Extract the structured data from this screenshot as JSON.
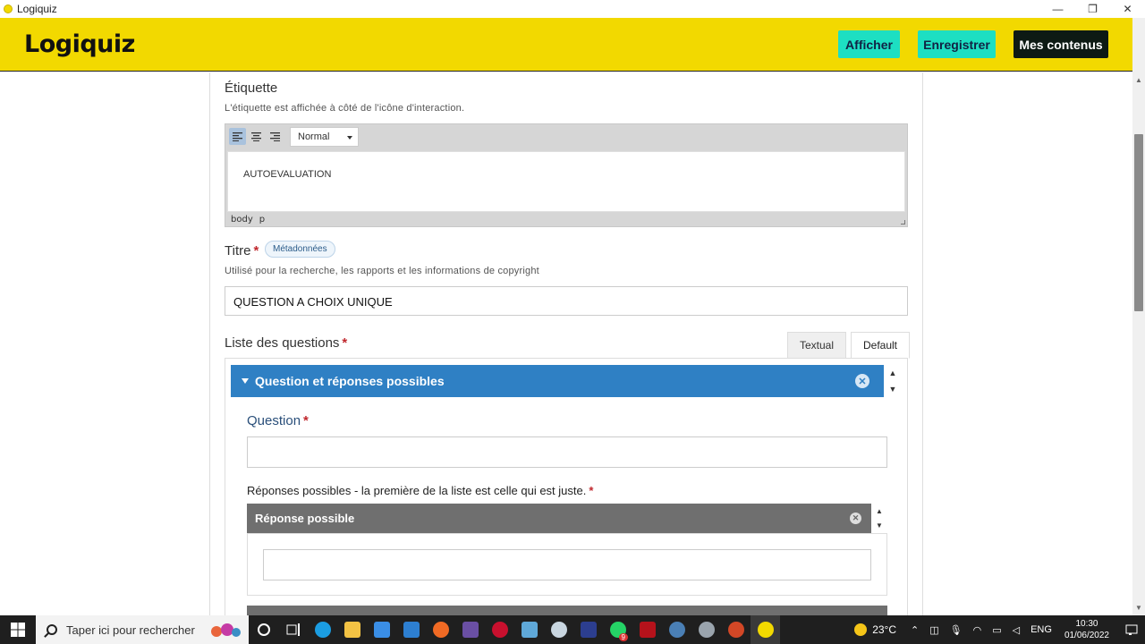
{
  "window": {
    "title": "Logiquiz",
    "minimize": "—",
    "restore": "❐",
    "close": "✕"
  },
  "header": {
    "logo": "Logiquiz",
    "btn_afficher": "Afficher",
    "btn_enregistrer": "Enregistrer",
    "btn_mes_contenus": "Mes contenus",
    "accent_color": "#f2d900",
    "button_color": "#1ddfc2"
  },
  "etiquette": {
    "label": "Étiquette",
    "description": "L'étiquette est affichée à côté de l'icône d'interaction.",
    "format_select": "Normal",
    "content": "AUTOEVALUATION",
    "path": [
      "body",
      "p"
    ]
  },
  "titre": {
    "label": "Titre",
    "required": "*",
    "badge": "Métadonnées",
    "description": "Utilisé pour la recherche, les rapports et les informations de copyright",
    "value": "QUESTION A CHOIX UNIQUE"
  },
  "questions": {
    "label": "Liste des questions",
    "required": "*",
    "tabs": [
      {
        "label": "Textual"
      },
      {
        "label": "Default"
      }
    ],
    "item_title": "Question et réponses possibles",
    "question_label": "Question",
    "question_value": "",
    "reponses_label": "Réponses possibles - la première de la liste est celle qui est juste.",
    "reponse_title": "Réponse possible",
    "reponse_value": ""
  },
  "taskbar": {
    "search_placeholder": "Taper ici pour rechercher",
    "weather": "23°C",
    "lang": "ENG",
    "time": "10:30",
    "date": "01/06/2022",
    "whatsapp_badge": "9"
  }
}
